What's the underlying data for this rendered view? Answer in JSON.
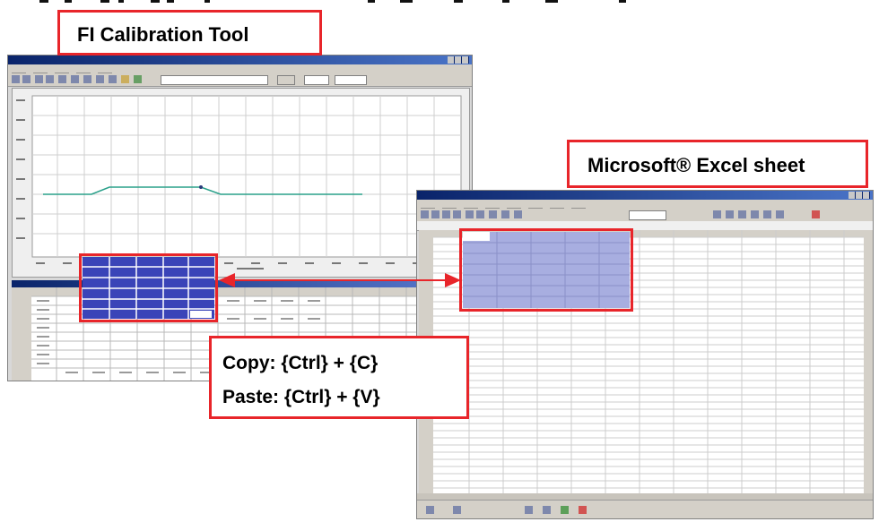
{
  "labels": {
    "fi_calibration_tool": "FI Calibration Tool",
    "microsoft_excel_sheet": "Microsoft® Excel sheet",
    "copy_shortcut": "Copy: {Ctrl} + {C}",
    "paste_shortcut": "Paste: {Ctrl} + {V}"
  },
  "colors": {
    "label_border": "#e8252a",
    "title_bar": "#0a246a",
    "selection_fi": "#3a44b8",
    "selection_excel": "#a8aee0",
    "chart_line": "#2aa08a"
  },
  "icons": {
    "bidirectional_arrow": "double-headed-arrow-red"
  }
}
